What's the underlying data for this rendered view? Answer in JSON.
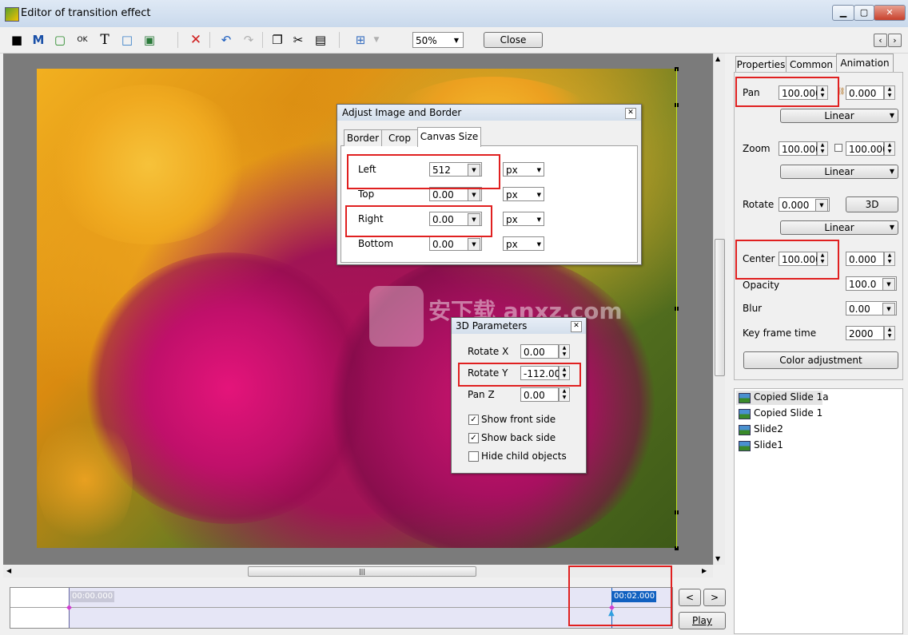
{
  "window": {
    "title": "Editor of transition effect",
    "minimize": "▁",
    "maximize": "▢",
    "close": "✕"
  },
  "toolbar": {
    "icons": [
      "camera-icon",
      "m-icon",
      "frame-icon",
      "ok-icon",
      "text-icon",
      "rectangle-icon",
      "image-icon",
      "delete-icon",
      "undo-icon",
      "redo-icon",
      "copy-icon",
      "cut-icon",
      "paste-icon",
      "grid-icon"
    ],
    "zoom": "50%",
    "close_label": "Close",
    "nav_prev": "‹",
    "nav_next": "›"
  },
  "adjust_dialog": {
    "title": "Adjust Image and Border",
    "tabs": [
      "Border",
      "Crop",
      "Canvas Size"
    ],
    "rows": [
      {
        "label": "Left",
        "value": "512",
        "unit": "px"
      },
      {
        "label": "Top",
        "value": "0.00",
        "unit": "px"
      },
      {
        "label": "Right",
        "value": "0.00",
        "unit": "px"
      },
      {
        "label": "Bottom",
        "value": "0.00",
        "unit": "px"
      }
    ]
  },
  "params_dialog": {
    "title": "3D Parameters",
    "rows": [
      {
        "label": "Rotate X",
        "value": "0.00"
      },
      {
        "label": "Rotate Y",
        "value": "-112.00"
      },
      {
        "label": "Pan Z",
        "value": "0.00"
      }
    ],
    "checks": [
      {
        "label": "Show front side",
        "checked": true
      },
      {
        "label": "Show back side",
        "checked": true
      },
      {
        "label": "Hide child objects",
        "checked": false
      }
    ]
  },
  "watermark": "安下载 anxz.com",
  "right_panel": {
    "tabs": [
      "Properties",
      "Common",
      "Animation"
    ],
    "pan": {
      "label": "Pan",
      "v1": "100.000",
      "v2": "0.000",
      "mode": "Linear"
    },
    "zoom": {
      "label": "Zoom",
      "v1": "100.000",
      "v2": "100.000",
      "mode": "Linear"
    },
    "rotate": {
      "label": "Rotate",
      "v1": "0.000",
      "btn": "3D",
      "mode": "Linear"
    },
    "center": {
      "label": "Center",
      "v1": "100.000",
      "v2": "0.000"
    },
    "opacity": {
      "label": "Opacity",
      "value": "100.0"
    },
    "blur": {
      "label": "Blur",
      "value": "0.00"
    },
    "keyframe": {
      "label": "Key frame time",
      "value": "2000"
    },
    "color_btn": "Color adjustment"
  },
  "objects": [
    "Copied Slide 1a",
    "Copied Slide 1",
    "Slide2",
    "Slide1"
  ],
  "timeline": {
    "start": "00:00.000",
    "end": "00:02.000",
    "prev": "<",
    "next": ">",
    "play": "Play"
  },
  "colors": {
    "highlight": "#e02020",
    "time_marker": "#1060c0"
  }
}
